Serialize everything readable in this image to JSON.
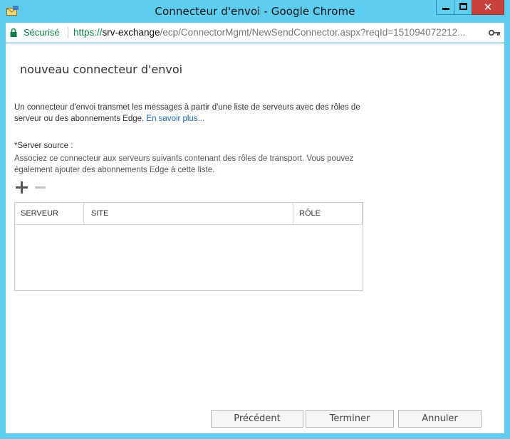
{
  "window": {
    "title": "Connecteur d'envoi - Google Chrome",
    "close_glyph": "✕"
  },
  "address_bar": {
    "secure_label": "Sécurisé",
    "url_scheme": "https://",
    "url_host": "srv-exchange",
    "url_path": "/ecp/ConnectorMgmt/NewSendConnector.aspx?reqId=151094072212..."
  },
  "page": {
    "title": "nouveau connecteur d'envoi",
    "description": "Un connecteur d'envoi transmet les messages à partir d'une liste de serveurs avec des rôles de serveur ou des abonnements Edge.",
    "learn_more": "En savoir plus...",
    "source_server_label": "*Server source :",
    "source_server_hint": "Associez ce connecteur aux serveurs suivants contenant des rôles de transport. Vous pouvez également ajouter des abonnements Edge à cette liste."
  },
  "grid": {
    "columns": [
      "SERVEUR",
      "SITE",
      "RÔLE"
    ],
    "rows": []
  },
  "buttons": {
    "previous": "Précédent",
    "finish": "Terminer",
    "cancel": "Annuler"
  },
  "colors": {
    "titlebar": "#5fcdf0",
    "close_button": "#c8403a",
    "secure_green": "#0b8043",
    "link_blue": "#1a66b8"
  },
  "icons": {
    "app": "exchange-envelope-icon",
    "lock": "lock-icon",
    "key": "key-icon",
    "add": "plus-icon",
    "remove": "minus-icon"
  }
}
